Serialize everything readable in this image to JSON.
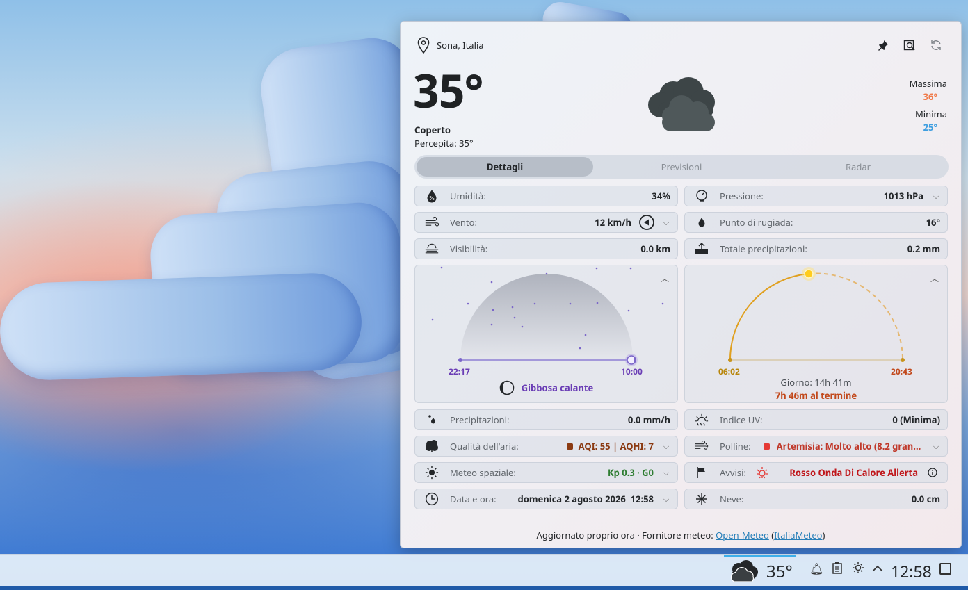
{
  "location": "Sona, Italia",
  "current": {
    "temperature": "35°",
    "condition": "Coperto",
    "feels_like": "Percepita: 35°"
  },
  "high": {
    "label": "Massima",
    "value": "36°"
  },
  "low": {
    "label": "Minima",
    "value": "25°"
  },
  "tabs": [
    "Dettagli",
    "Previsioni",
    "Radar"
  ],
  "details": {
    "humidity": {
      "label": "Umidità:",
      "value": "34%"
    },
    "pressure": {
      "label": "Pressione:",
      "value": "1013 hPa"
    },
    "wind": {
      "label": "Vento:",
      "value": "12 km/h"
    },
    "dew_point": {
      "label": "Punto di rugiada:",
      "value": "16°"
    },
    "visibility": {
      "label": "Visibilità:",
      "value": "0.0 km"
    },
    "total_precip": {
      "label": "Totale precipitazioni:",
      "value": "0.2 mm"
    },
    "precip": {
      "label": "Precipitazioni:",
      "value": "0.0 mm/h"
    },
    "uv": {
      "label": "Indice UV:",
      "value": "0 (Minima)"
    },
    "air_quality": {
      "label": "Qualità dell'aria:",
      "value": "AQI: 55 | AQHI: 7",
      "color": "#8b3a12"
    },
    "pollen": {
      "label": "Polline:",
      "value": "Artemisia: Molto alto (8.2 granu...",
      "color": "#c0392b"
    },
    "space_weather": {
      "label": "Meteo spaziale:",
      "value": "Kp 0.3 · G0",
      "color": "#2e7d32"
    },
    "alerts": {
      "label": "Avvisi:",
      "value": "Rosso Onda Di Calore Allerta",
      "color": "#c0171b"
    },
    "datetime": {
      "label": "Data e ora:",
      "value": "domenica 2 agosto 2026  12:58"
    },
    "snow": {
      "label": "Neve:",
      "value": "0.0 cm"
    }
  },
  "moon": {
    "rise": "22:17",
    "set": "10:00",
    "phase": "Gibbosa calante",
    "color": "#6a3db5"
  },
  "sun": {
    "rise": "06:02",
    "set": "20:43",
    "daylight": "Giorno: 14h 41m",
    "remaining": "7h 46m al termine",
    "rise_color": "#b8860b",
    "set_color": "#c2491c"
  },
  "footer": {
    "text": "Aggiornato proprio ora · Fornitore meteo: ",
    "link1": "Open-Meteo",
    "link2": "ItaliaMeteo"
  },
  "taskbar": {
    "temperature": "35°",
    "clock": "12:58"
  }
}
